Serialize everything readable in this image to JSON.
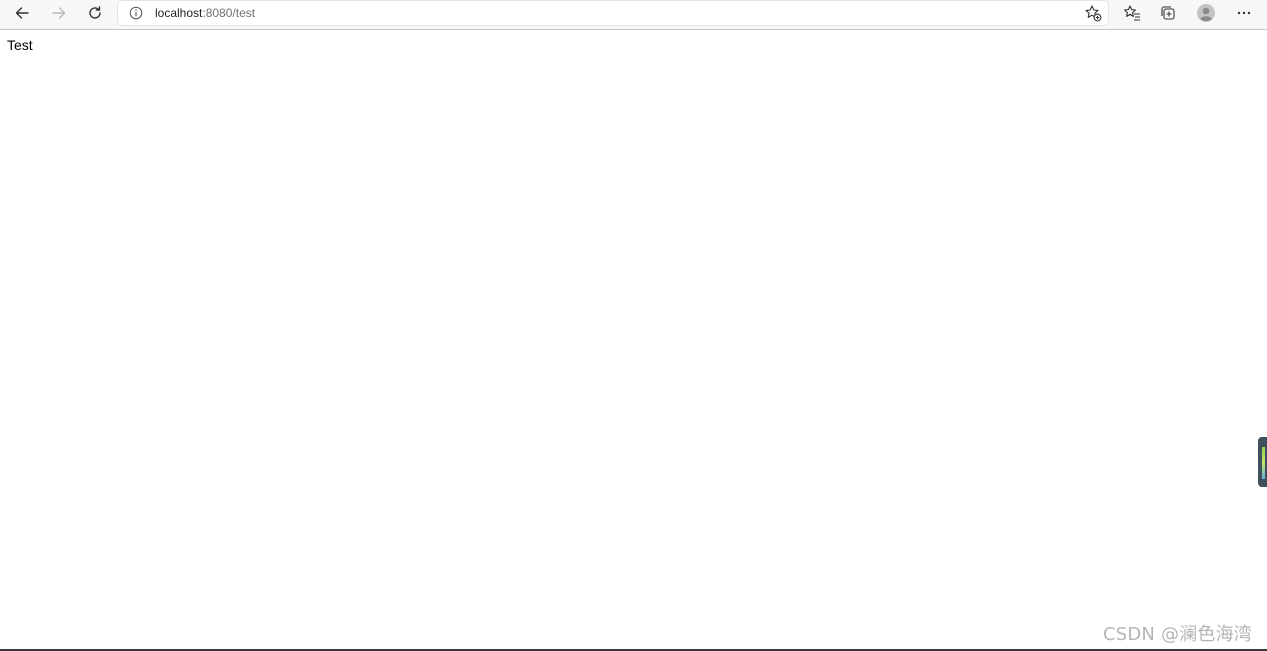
{
  "browser": {
    "icons": {
      "back": "arrow-left-icon",
      "forward": "arrow-right-icon",
      "refresh": "refresh-icon",
      "site_info": "info-icon",
      "add_favorite": "star-plus-icon",
      "favorites": "favorites-list-icon",
      "collections": "collections-icon",
      "profile": "profile-avatar-icon",
      "menu": "more-dots-icon"
    },
    "address": {
      "host": "localhost",
      "rest": ":8080/test"
    },
    "forward_enabled": false
  },
  "page": {
    "content_text": "Test"
  },
  "watermark": {
    "text": "CSDN @澜色海湾"
  },
  "colors": {
    "toolbar_bg": "#f7f7f7",
    "page_bg": "#ffffff",
    "icon": "#333333",
    "icon_disabled": "#b9b9b9"
  }
}
